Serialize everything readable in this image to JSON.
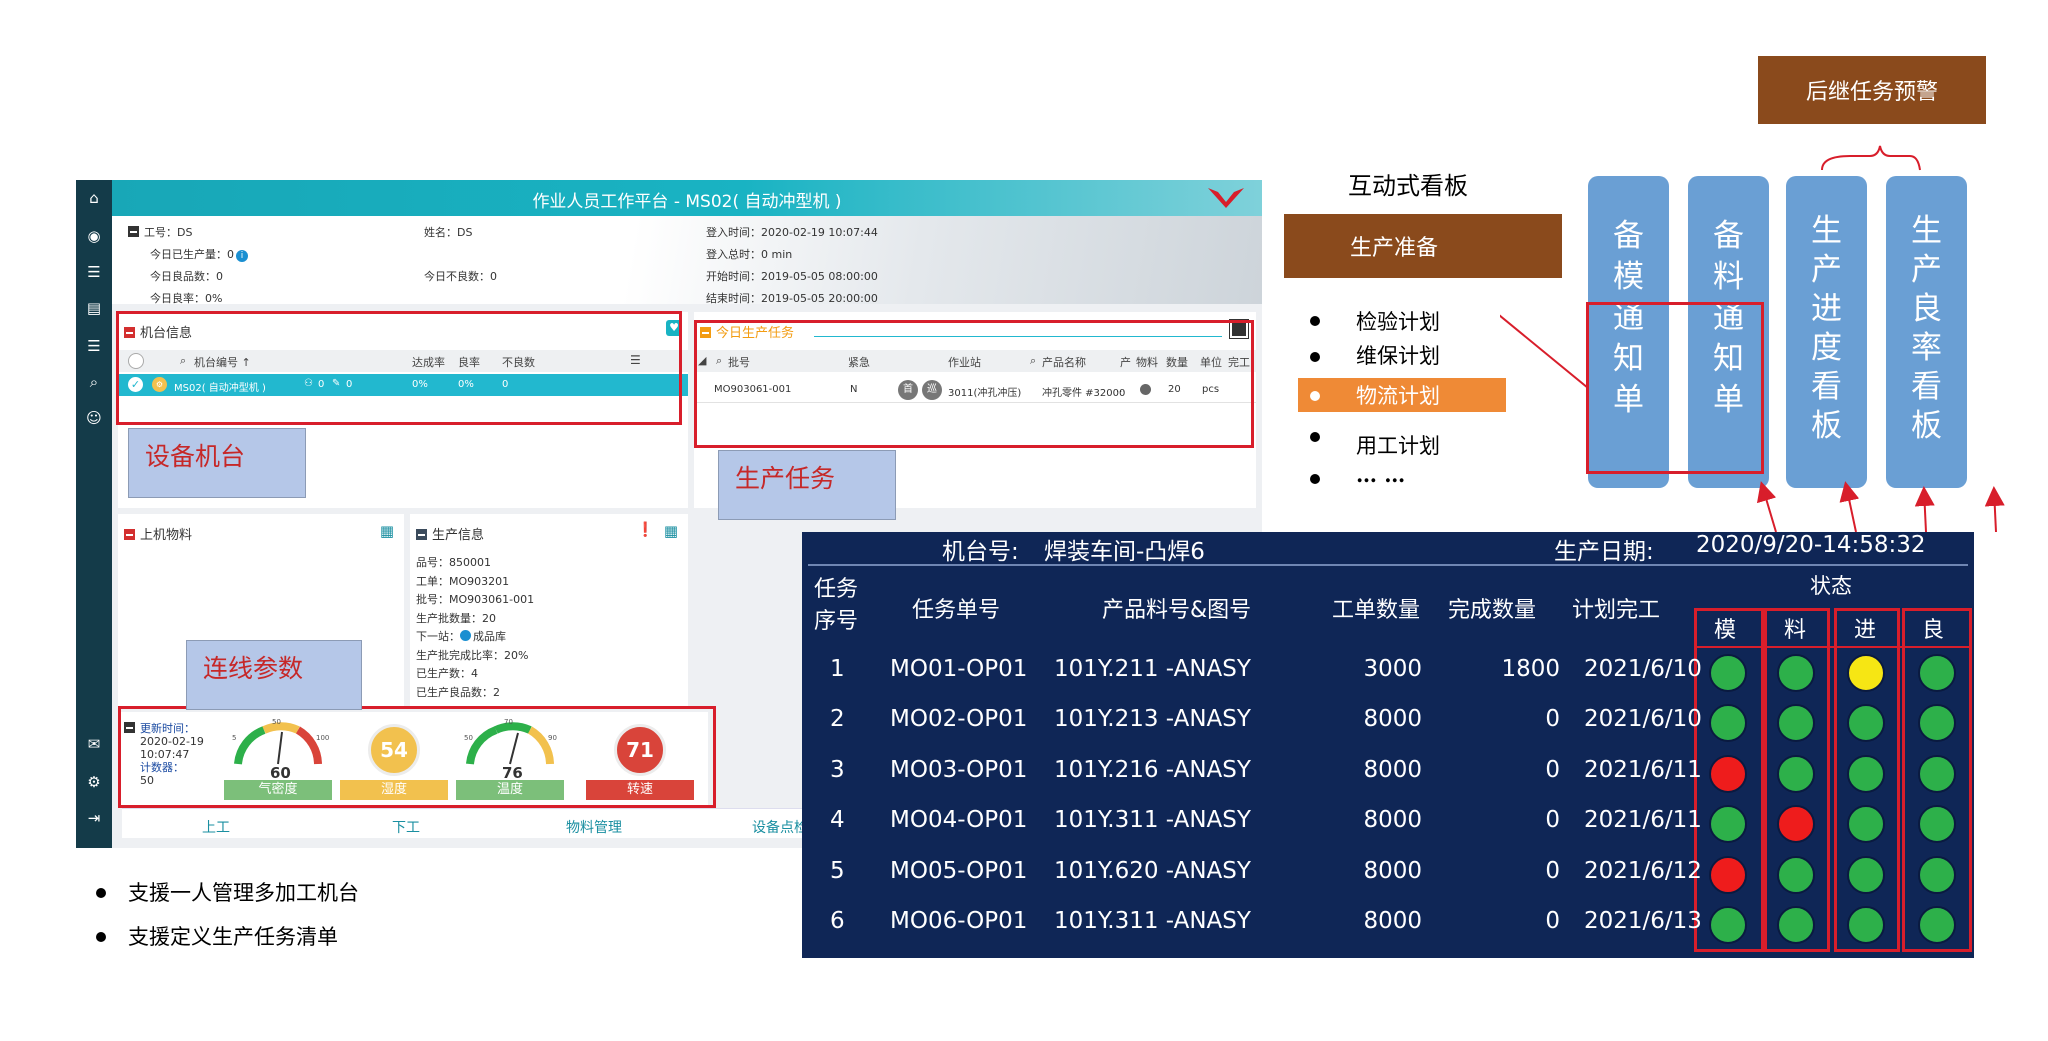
{
  "app": {
    "title": "作业人员工作平台 - MS02( 自动冲型机 )",
    "info": {
      "worker": "工号：DS",
      "today_output": "今日已生产量：0",
      "today_good": "今日良品数：0",
      "today_yield": "今日良率：0%",
      "name": "姓名：DS",
      "today_bad": "今日不良数：0",
      "login_time": "登入时间：2020-02-19 10:07:44",
      "login_total": "登入总时：0 min",
      "start_time": "开始时间：2019-05-05 08:00:00",
      "end_time": "结束时间：2019-05-05 20:00:00"
    },
    "machine_panel": {
      "title": "机台信息",
      "headers": [
        "机台编号 ↑",
        "达成率",
        "良率",
        "不良数"
      ],
      "row": {
        "id": "MS02( 自动冲型机 )",
        "c1": "0",
        "c2": "0",
        "rate": "0%",
        "yield": "0%",
        "bad": "0"
      }
    },
    "task_panel": {
      "title": "今日生产任务",
      "headers": [
        "批号",
        "紧急",
        "作业站",
        "产品名称",
        "产",
        "物料",
        "数量",
        "单位",
        "完工"
      ],
      "row": {
        "batch": "MO903061-001",
        "urgent": "N",
        "b1": "首",
        "b2": "巡",
        "station": "3011(冲孔冲压)",
        "product": "冲孔零件 #32000",
        "more": "...",
        "qty": "20",
        "unit": "pcs"
      }
    },
    "material_panel": {
      "title": "上机物料"
    },
    "prod_panel": {
      "title": "生产信息",
      "lines": [
        "品号：850001",
        "工单：MO903201",
        "批号：MO903061-001",
        "生产批数量：20",
        "下一站：",
        "生产批完成比率：20%",
        "已生产数：4",
        "已生产良品数：2"
      ],
      "next_station": "成品库"
    },
    "params": {
      "update_label": "更新时间：",
      "update_date": "2020-02-19",
      "update_time": "10:07:47",
      "count_label": "计数器：",
      "count_value": "50",
      "gauges": [
        {
          "label": "气密度",
          "value": "60",
          "min": "5",
          "mid": "50",
          "max": "100",
          "color": "#7cbf7a"
        },
        {
          "label": "湿度",
          "value": "54",
          "color": "#f2c14e"
        },
        {
          "label": "温度",
          "value": "76",
          "min": "50",
          "mid": "70",
          "max": "90",
          "color": "#7cbf7a"
        },
        {
          "label": "转速",
          "value": "71",
          "color": "#d9443a"
        }
      ]
    },
    "bottom_tabs": [
      "上工",
      "下工",
      "物料管理",
      "设备点检"
    ]
  },
  "callouts": {
    "machine": "设备机台",
    "task": "生产任务",
    "params": "连线参数"
  },
  "notes": [
    "支援一人管理多加工机台",
    "支援定义生产任务清单"
  ],
  "kanban": {
    "title": "互动式看板",
    "prep": "生产准备",
    "items": [
      "检验计划",
      "维保计划",
      "物流计划",
      "用工计划",
      "… …"
    ]
  },
  "warning": "后继任务预警",
  "columns": [
    "备模通知单",
    "备料通知单",
    "生产进度看板",
    "生产良率看板"
  ],
  "board": {
    "machine_label": "机台号:",
    "machine_value": "焊装车间-凸焊6",
    "date_label": "生产日期:",
    "date_value": "2020/9/20-14:58:32",
    "status_label": "状态",
    "headers": [
      "任务\n序号",
      "任务单号",
      "产品料号&图号",
      "工单数量",
      "完成数量",
      "计划完工"
    ],
    "status_headers": [
      "模",
      "料",
      "进",
      "良"
    ],
    "rows": [
      {
        "no": "1",
        "order": "MO01-OP01",
        "part": "101Y.211 -ANASY",
        "qty": "3000",
        "done": "1800",
        "date": "2021/6/10",
        "status": [
          "green",
          "green",
          "yellow",
          "green"
        ]
      },
      {
        "no": "2",
        "order": "MO02-OP01",
        "part": "101Y.213 -ANASY",
        "qty": "8000",
        "done": "0",
        "date": "2021/6/10",
        "status": [
          "green",
          "green",
          "green",
          "green"
        ]
      },
      {
        "no": "3",
        "order": "MO03-OP01",
        "part": "101Y.216 -ANASY",
        "qty": "8000",
        "done": "0",
        "date": "2021/6/11",
        "status": [
          "red",
          "green",
          "green",
          "green"
        ]
      },
      {
        "no": "4",
        "order": "MO04-OP01",
        "part": "101Y.311 -ANASY",
        "qty": "8000",
        "done": "0",
        "date": "2021/6/11",
        "status": [
          "green",
          "red",
          "green",
          "green"
        ]
      },
      {
        "no": "5",
        "order": "MO05-OP01",
        "part": "101Y.620 -ANASY",
        "qty": "8000",
        "done": "0",
        "date": "2021/6/12",
        "status": [
          "red",
          "green",
          "green",
          "green"
        ]
      },
      {
        "no": "6",
        "order": "MO06-OP01",
        "part": "101Y.311 -ANASY",
        "qty": "8000",
        "done": "0",
        "date": "2021/6/13",
        "status": [
          "green",
          "green",
          "green",
          "green"
        ]
      }
    ],
    "colors": {
      "green": "#2db04a",
      "yellow": "#f6e614",
      "red": "#ee1c1c",
      "bg": "#0f2656",
      "frame": "#d81e2b"
    }
  }
}
